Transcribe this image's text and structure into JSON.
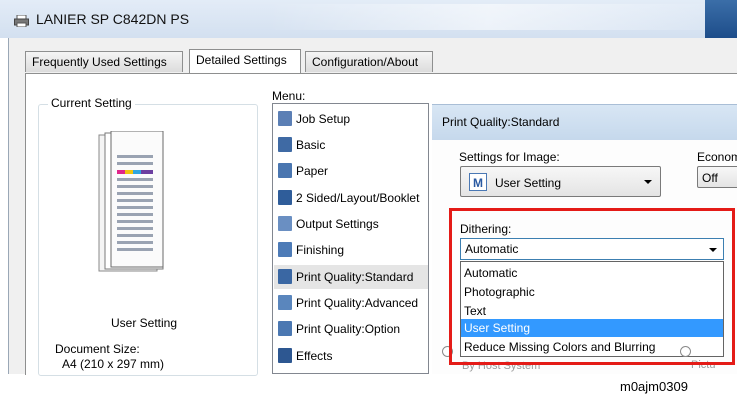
{
  "window": {
    "title": "LANIER SP C842DN PS",
    "icon": "printer-icon"
  },
  "tabs": [
    {
      "label": "Frequently Used Settings",
      "active": false
    },
    {
      "label": "Detailed Settings",
      "active": true
    },
    {
      "label": "Configuration/About",
      "active": false
    }
  ],
  "current_setting": {
    "group_title": "Current Setting",
    "setting_name": "User Setting",
    "document_size_label": "Document Size:",
    "document_size_value": "A4 (210 x 297 mm)"
  },
  "menu": {
    "label": "Menu:",
    "items": [
      {
        "label": "Job Setup",
        "icon": "job-setup-icon",
        "selected": false
      },
      {
        "label": "Basic",
        "icon": "basic-icon",
        "selected": false
      },
      {
        "label": "Paper",
        "icon": "paper-icon",
        "selected": false
      },
      {
        "label": "2 Sided/Layout/Booklet",
        "icon": "layout-icon",
        "selected": false
      },
      {
        "label": "Output Settings",
        "icon": "output-icon",
        "selected": false
      },
      {
        "label": "Finishing",
        "icon": "finishing-icon",
        "selected": false
      },
      {
        "label": "Print Quality:Standard",
        "icon": "print-quality-icon",
        "selected": true
      },
      {
        "label": "Print Quality:Advanced",
        "icon": "print-quality-advanced-icon",
        "selected": false
      },
      {
        "label": "Print Quality:Option",
        "icon": "print-quality-option-icon",
        "selected": false
      },
      {
        "label": "Effects",
        "icon": "effects-icon",
        "selected": false
      }
    ]
  },
  "panel": {
    "header": "Print Quality:Standard",
    "settings_for_image_label": "Settings for Image:",
    "settings_for_image_value": "User Setting",
    "settings_for_image_badge": "M",
    "economy_label": "Econom",
    "economy_value": "Off",
    "dithering_label": "Dithering:",
    "dithering_value": "Automatic",
    "dithering_options": [
      {
        "label": "Automatic",
        "selected": false
      },
      {
        "label": "Photographic",
        "selected": false
      },
      {
        "label": "Text",
        "selected": false
      },
      {
        "label": "User Setting",
        "selected": true
      },
      {
        "label": "Reduce Missing Colors and Blurring",
        "selected": false
      }
    ],
    "behind_left": "By Host System",
    "behind_right": "Pictu"
  },
  "caption": "m0ajm0309",
  "colors": {
    "highlight": "#e41b17",
    "selection": "#3399ff",
    "panel_header": "#d8e6f4"
  }
}
